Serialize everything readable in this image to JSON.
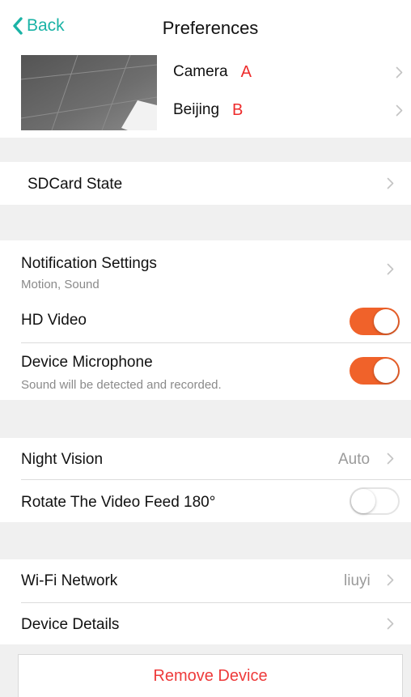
{
  "nav": {
    "back_label": "Back",
    "title": "Preferences"
  },
  "device": {
    "name": "Camera",
    "name_tag": "A",
    "location": "Beijing",
    "location_tag": "B"
  },
  "sdcard": {
    "label": "SDCard State"
  },
  "notifications": {
    "label": "Notification Settings",
    "sub": "Motion, Sound"
  },
  "hd_video": {
    "label": "HD Video",
    "enabled": true
  },
  "microphone": {
    "label": "Device Microphone",
    "sub": "Sound will be detected and recorded.",
    "enabled": true
  },
  "night_vision": {
    "label": "Night Vision",
    "value": "Auto"
  },
  "rotate": {
    "label": "Rotate The Video Feed 180°",
    "enabled": false
  },
  "wifi": {
    "label": "Wi-Fi Network",
    "value": "liuyi"
  },
  "details": {
    "label": "Device Details"
  },
  "remove": {
    "label": "Remove Device"
  },
  "colors": {
    "accent": "#1bb3a6",
    "toggle_on": "#f0622a",
    "danger": "#ee3b3b"
  },
  "icons": [
    "back-chevron-icon",
    "chevron-right-icon",
    "camera-thumbnail"
  ]
}
